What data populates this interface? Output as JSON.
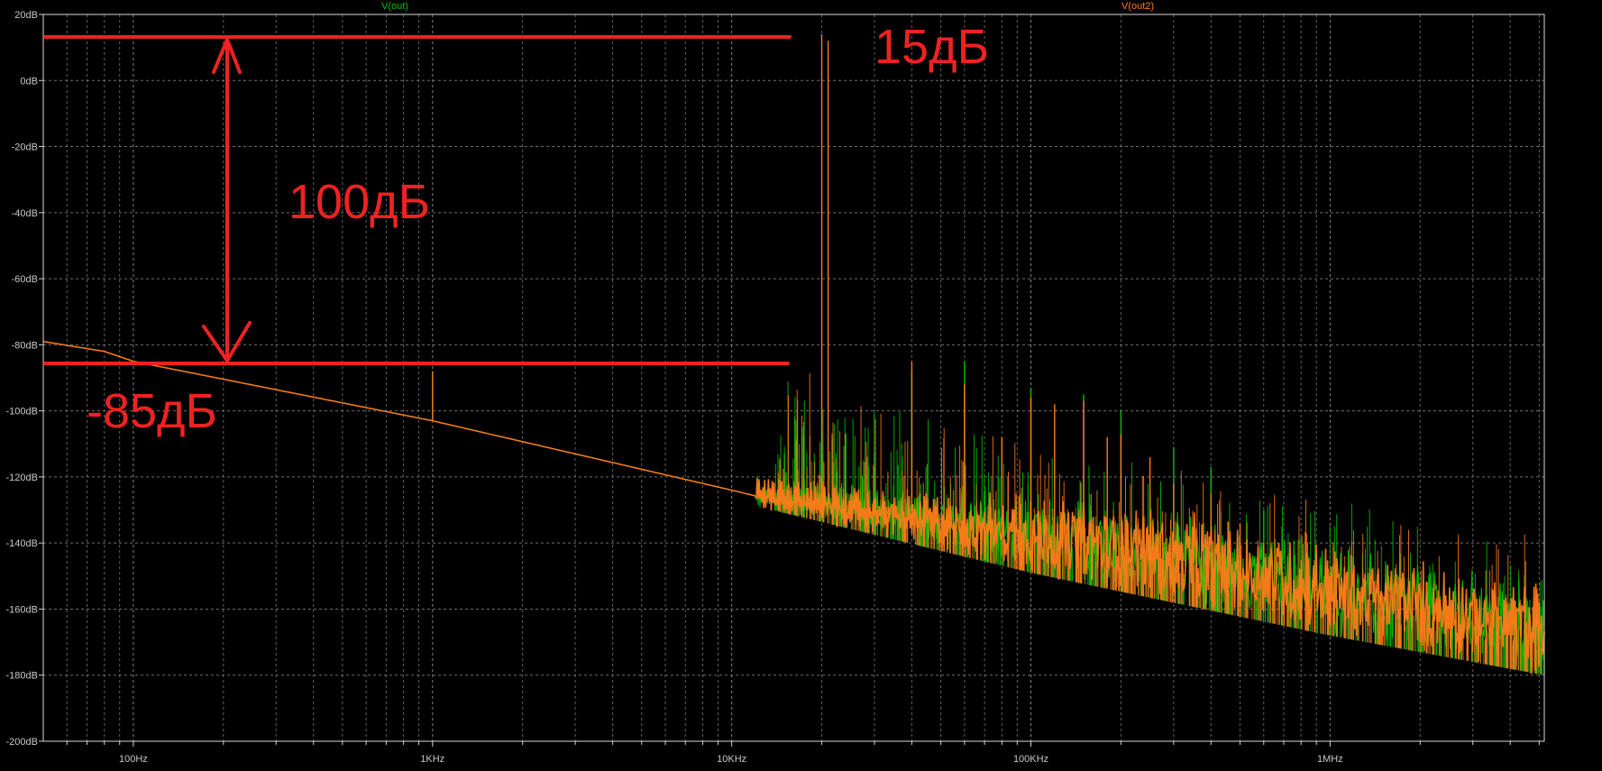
{
  "chart_data": {
    "type": "line",
    "x_scale": "log",
    "xlim": [
      50,
      5200000
    ],
    "ylim": [
      -200,
      20
    ],
    "grid": true,
    "y_ticks": [
      {
        "value": 20,
        "label": "20dB"
      },
      {
        "value": 0,
        "label": "0dB"
      },
      {
        "value": -20,
        "label": "-20dB"
      },
      {
        "value": -40,
        "label": "-40dB"
      },
      {
        "value": -60,
        "label": "-60dB"
      },
      {
        "value": -80,
        "label": "-80dB"
      },
      {
        "value": -100,
        "label": "-100dB"
      },
      {
        "value": -120,
        "label": "-120dB"
      },
      {
        "value": -140,
        "label": "-140dB"
      },
      {
        "value": -160,
        "label": "-160dB"
      },
      {
        "value": -180,
        "label": "-180dB"
      },
      {
        "value": -200,
        "label": "-200dB"
      }
    ],
    "x_ticks": [
      {
        "value": 100,
        "label": "100Hz"
      },
      {
        "value": 1000,
        "label": "1KHz"
      },
      {
        "value": 10000,
        "label": "10KHz"
      },
      {
        "value": 100000,
        "label": "100KHz"
      },
      {
        "value": 1000000,
        "label": "1MHz"
      }
    ],
    "series": [
      {
        "name": "V(out)",
        "color": "#00c000",
        "floor": [
          [
            50,
            -79
          ],
          [
            80,
            -82
          ],
          [
            100,
            -85
          ],
          [
            1000,
            -103
          ],
          [
            10000,
            -124
          ],
          [
            100000,
            -146
          ],
          [
            1000000,
            -165
          ],
          [
            5200000,
            -177
          ]
        ],
        "spikes": [
          [
            1000,
            -88
          ],
          [
            15000,
            -113
          ],
          [
            20000,
            -110
          ],
          [
            30000,
            -117
          ],
          [
            40000,
            -88
          ],
          [
            60000,
            -85
          ],
          [
            100000,
            -93
          ],
          [
            150000,
            -95
          ],
          [
            200000,
            -100
          ],
          [
            300000,
            -111
          ],
          [
            400000,
            -117
          ],
          [
            600000,
            -130
          ],
          [
            1000000,
            -152
          ],
          [
            2000000,
            -167
          ],
          [
            4000000,
            -170
          ]
        ]
      },
      {
        "name": "V(out2)",
        "color": "#ff7a1a",
        "floor": [
          [
            50,
            -79
          ],
          [
            80,
            -82
          ],
          [
            100,
            -85
          ],
          [
            1000,
            -103
          ],
          [
            10000,
            -124
          ],
          [
            100000,
            -146
          ],
          [
            1000000,
            -165
          ],
          [
            5200000,
            -177
          ]
        ],
        "spikes": [
          [
            1000,
            -88
          ],
          [
            20000,
            14
          ],
          [
            21000,
            12
          ],
          [
            40000,
            -85
          ],
          [
            60000,
            -92
          ],
          [
            80000,
            -108
          ],
          [
            100000,
            -96
          ],
          [
            120000,
            -98
          ],
          [
            150000,
            -97
          ],
          [
            180000,
            -108
          ],
          [
            200000,
            -107
          ],
          [
            250000,
            -114
          ],
          [
            300000,
            -122
          ],
          [
            400000,
            -125
          ],
          [
            500000,
            -134
          ],
          [
            600000,
            -140
          ],
          [
            800000,
            -145
          ],
          [
            1000000,
            -150
          ],
          [
            2000000,
            -160
          ],
          [
            3000000,
            -155
          ],
          [
            4000000,
            -166
          ],
          [
            5000000,
            -158
          ]
        ]
      }
    ]
  },
  "annotations": {
    "top_level_label": "15дБ",
    "range_label": "100дБ",
    "bottom_level_label": "-85дБ",
    "color": "#ee2222"
  }
}
